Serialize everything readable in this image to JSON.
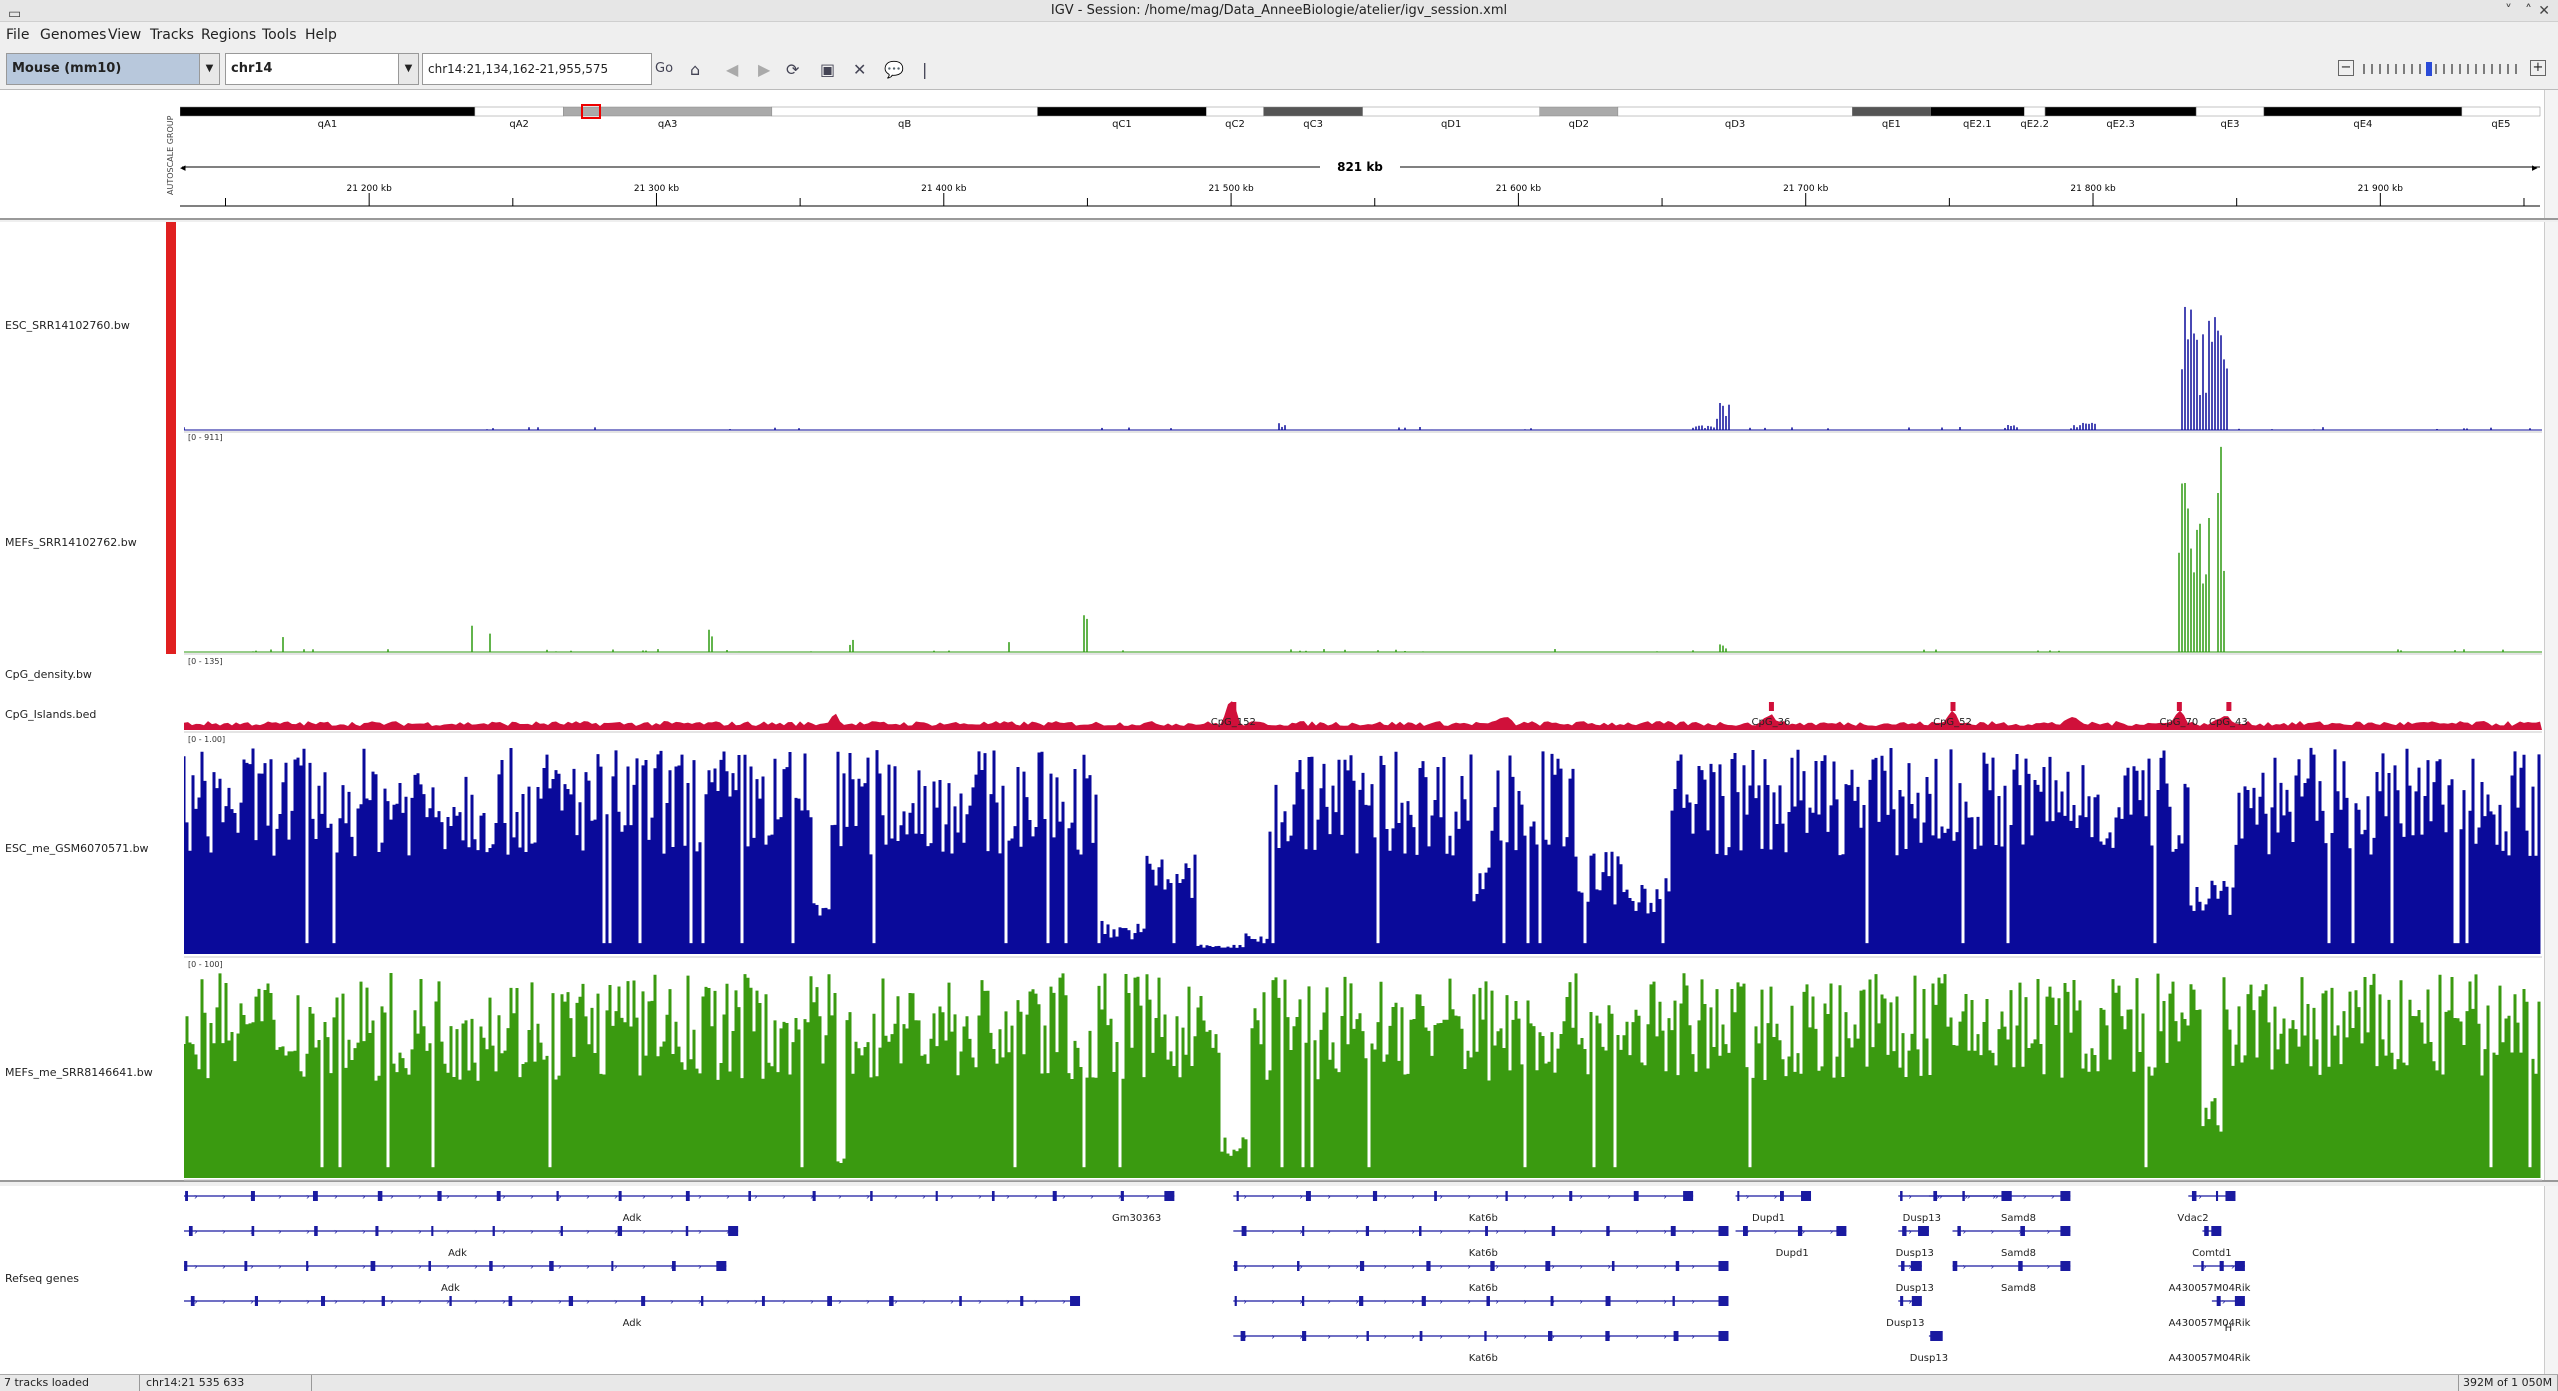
{
  "window": {
    "title": "IGV - Session: /home/mag/Data_AnneeBiologie/atelier/igv_session.xml"
  },
  "menu": [
    "File",
    "Genomes",
    "View",
    "Tracks",
    "Regions",
    "Tools",
    "Help"
  ],
  "toolbar": {
    "genome": "Mouse (mm10)",
    "chromosome": "chr14",
    "locus": "chr14:21,134,162-21,955,575",
    "go_label": "Go"
  },
  "ideogram": {
    "bands": [
      {
        "label": "qA1",
        "stain": "black"
      },
      {
        "label": "qA2",
        "stain": "white"
      },
      {
        "label": "qA3",
        "stain": "grey"
      },
      {
        "label": "qB",
        "stain": "white"
      },
      {
        "label": "qC1",
        "stain": "black"
      },
      {
        "label": "qC2",
        "stain": "white"
      },
      {
        "label": "qC3",
        "stain": "darkgrey"
      },
      {
        "label": "qD1",
        "stain": "white"
      },
      {
        "label": "qD2",
        "stain": "grey"
      },
      {
        "label": "qD3",
        "stain": "white"
      },
      {
        "label": "qE1",
        "stain": "darkgrey"
      },
      {
        "label": "qE2.1",
        "stain": "black"
      },
      {
        "label": "qE2.2",
        "stain": "white"
      },
      {
        "label": "qE2.3",
        "stain": "black"
      },
      {
        "label": "qE3",
        "stain": "white"
      },
      {
        "label": "qE4",
        "stain": "black"
      },
      {
        "label": "qE5",
        "stain": "white"
      }
    ],
    "span_label": "821 kb",
    "ticks": [
      "21 200 kb",
      "21 300 kb",
      "21 400 kb",
      "21 500 kb",
      "21 600 kb",
      "21 700 kb",
      "21 800 kb",
      "21 900 kb"
    ],
    "autoscale_label": "AUTOSCALE GROUP"
  },
  "tracks": [
    {
      "name": "ESC_SRR14102760.bw",
      "range": "",
      "color": "#0a0a9a"
    },
    {
      "name": "MEFs_SRR14102762.bw",
      "range": "[0 - 911]",
      "color": "#2e9a10"
    },
    {
      "name": "CpG_density.bw",
      "range": "[0 - 135]",
      "color": "#d0103a"
    },
    {
      "name": "CpG_Islands.bed",
      "range": "",
      "color": "#d0103a"
    },
    {
      "name": "ESC_me_GSM6070571.bw",
      "range": "[0 - 1.00]",
      "color": "#0a0a9a"
    },
    {
      "name": "MEFs_me_SRR8146641.bw",
      "range": "[0 - 100]",
      "color": "#3a9a10"
    }
  ],
  "cpg_islands": [
    {
      "label": "CpG_152",
      "pos": 0.445
    },
    {
      "label": "CpG_36",
      "pos": 0.673
    },
    {
      "label": "CpG_52",
      "pos": 0.75
    },
    {
      "label": "CpG_70",
      "pos": 0.846
    },
    {
      "label": "CpG_43",
      "pos": 0.867
    }
  ],
  "refseq": {
    "name": "Refseq genes",
    "labels": [
      {
        "text": "Adk",
        "x": 0.19,
        "row": 0
      },
      {
        "text": "Gm30363",
        "x": 0.404,
        "row": 0
      },
      {
        "text": "Kat6b",
        "x": 0.551,
        "row": 0
      },
      {
        "text": "Dupd1",
        "x": 0.672,
        "row": 0
      },
      {
        "text": "Dusp13",
        "x": 0.737,
        "row": 0
      },
      {
        "text": "Samd8",
        "x": 0.778,
        "row": 0
      },
      {
        "text": "Vdac2",
        "x": 0.852,
        "row": 0
      },
      {
        "text": "Adk",
        "x": 0.116,
        "row": 1
      },
      {
        "text": "Kat6b",
        "x": 0.551,
        "row": 1
      },
      {
        "text": "Dupd1",
        "x": 0.682,
        "row": 1
      },
      {
        "text": "Dusp13",
        "x": 0.734,
        "row": 1
      },
      {
        "text": "Samd8",
        "x": 0.778,
        "row": 1
      },
      {
        "text": "Comtd1",
        "x": 0.86,
        "row": 1
      },
      {
        "text": "Adk",
        "x": 0.113,
        "row": 2
      },
      {
        "text": "Kat6b",
        "x": 0.551,
        "row": 2
      },
      {
        "text": "Dusp13",
        "x": 0.734,
        "row": 2
      },
      {
        "text": "Samd8",
        "x": 0.778,
        "row": 2
      },
      {
        "text": "A430057M04Rik",
        "x": 0.859,
        "row": 2
      },
      {
        "text": "Adk",
        "x": 0.19,
        "row": 3
      },
      {
        "text": "Dusp13",
        "x": 0.73,
        "row": 3
      },
      {
        "text": "A430057M04Rik",
        "x": 0.859,
        "row": 3
      },
      {
        "text": "H",
        "x": 0.867,
        "row": 3.5
      },
      {
        "text": "Kat6b",
        "x": 0.551,
        "row": 4
      },
      {
        "text": "Dusp13",
        "x": 0.74,
        "row": 4
      },
      {
        "text": "A430057M04Rik",
        "x": 0.859,
        "row": 4
      }
    ]
  },
  "status": {
    "tracks_loaded": "7 tracks loaded",
    "position": "chr14:21 535 633",
    "memory": "392M of 1 050M"
  }
}
